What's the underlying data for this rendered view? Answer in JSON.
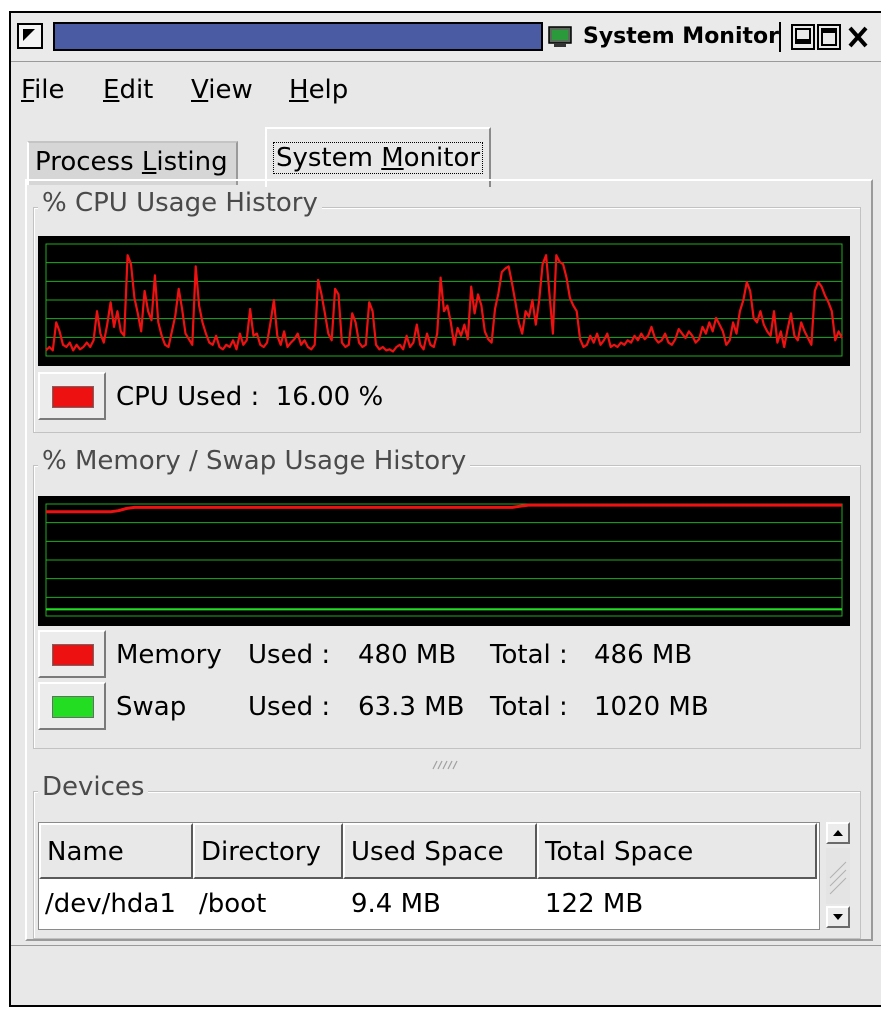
{
  "window": {
    "title": "System Monitor",
    "menu_icon": "triangle-menu-icon",
    "buttons": [
      "minimize-icon",
      "maximize-icon",
      "close-icon"
    ]
  },
  "menubar": [
    {
      "underline": "F",
      "rest": "ile"
    },
    {
      "underline": "E",
      "rest": "dit"
    },
    {
      "underline": "V",
      "rest": "iew"
    },
    {
      "underline": "H",
      "rest": "elp"
    }
  ],
  "tabs": {
    "process": {
      "before": "Process ",
      "underline": "L",
      "after": "isting"
    },
    "sysmon": {
      "before": "System ",
      "underline": "M",
      "after": "onitor"
    },
    "active": "System Monitor"
  },
  "cpu": {
    "title": "% CPU Usage History",
    "legend_label": "CPU Used :",
    "legend_value": "16.00 %",
    "color": "#ee1111"
  },
  "memory": {
    "title": "% Memory / Swap Usage History",
    "mem_name": "Memory",
    "mem_used_label": "Used :",
    "mem_used_value": "480 MB",
    "mem_total_label": "Total :",
    "mem_total_value": "486 MB",
    "swap_name": "Swap",
    "swap_used_label": "Used :",
    "swap_used_value": "63.3 MB",
    "swap_total_label": "Total :",
    "swap_total_value": "1020 MB",
    "mem_color": "#ee1111",
    "swap_color": "#22dd22"
  },
  "devices": {
    "title": "Devices",
    "columns": [
      "Name",
      "Directory",
      "Used Space",
      "Total Space"
    ],
    "rows": [
      {
        "name": "/dev/hda1",
        "directory": "/boot",
        "used": "9.4 MB",
        "total": "122 MB"
      }
    ]
  },
  "colors": {
    "graph_bg": "#000000",
    "grid": "#22aa22",
    "cpu_line": "#ee1111",
    "mem_line": "#ee1111",
    "swap_line": "#22dd22",
    "title_bar": "#4a5aa3"
  },
  "chart_data": [
    {
      "type": "line",
      "name": "cpu-usage-history",
      "series": [
        {
          "values": [
            5,
            8,
            5,
            30,
            22,
            10,
            8,
            12,
            5,
            10,
            6,
            8,
            12,
            8,
            14,
            40,
            20,
            12,
            28,
            48,
            26,
            40,
            22,
            18,
            90,
            82,
            52,
            38,
            22,
            58,
            40,
            32,
            72,
            30,
            18,
            10,
            8,
            22,
            36,
            60,
            42,
            20,
            15,
            10,
            80,
            45,
            30,
            20,
            12,
            10,
            18,
            8,
            6,
            10,
            8,
            14,
            6,
            20,
            10,
            14,
            42,
            18,
            20,
            10,
            8,
            12,
            30,
            50,
            18,
            10,
            22,
            8,
            12,
            15,
            20,
            10,
            14,
            8,
            6,
            10,
            68,
            55,
            38,
            20,
            14,
            60,
            55,
            12,
            8,
            10,
            38,
            30,
            12,
            8,
            10,
            48,
            40,
            10,
            6,
            8,
            5,
            6,
            4,
            8,
            10,
            6,
            18,
            8,
            12,
            28,
            10,
            6,
            20,
            10,
            8,
            20,
            70,
            40,
            45,
            30,
            10,
            25,
            18,
            28,
            15,
            62,
            38,
            55,
            45,
            22,
            15,
            12,
            42,
            56,
            75,
            78,
            80,
            65,
            48,
            30,
            20,
            40,
            35,
            50,
            28,
            50,
            82,
            90,
            55,
            20,
            90,
            84,
            82,
            70,
            52,
            45,
            40,
            15,
            8,
            10,
            18,
            12,
            20,
            10,
            14,
            20,
            8,
            10,
            8,
            12,
            10,
            14,
            12,
            18,
            14,
            20,
            15,
            18,
            26,
            16,
            12,
            14,
            20,
            12,
            10,
            15,
            24,
            20,
            16,
            22,
            18,
            12,
            15,
            26,
            20,
            30,
            22,
            34,
            28,
            22,
            10,
            14,
            30,
            20,
            40,
            50,
            66,
            58,
            34,
            30,
            40,
            28,
            22,
            18,
            40,
            12,
            22,
            8,
            24,
            38,
            18,
            14,
            30,
            22,
            16,
            10,
            58,
            66,
            62,
            54,
            48,
            40,
            14,
            22,
            16
          ]
        }
      ]
    },
    {
      "type": "line",
      "name": "memory-swap-usage-history",
      "series": [
        {
          "name": "Memory",
          "values": [
            93,
            93,
            93,
            93,
            93,
            93,
            93,
            93,
            93,
            94,
            96,
            97,
            97,
            97,
            97,
            97,
            97,
            97,
            97,
            97,
            97,
            97,
            97,
            97,
            97,
            97,
            97,
            97,
            97,
            97,
            97,
            97,
            97,
            97,
            97,
            97,
            97,
            97,
            97,
            97,
            97,
            97,
            97,
            97,
            97,
            97,
            97,
            97,
            97,
            97,
            97,
            97,
            97,
            97,
            97,
            97,
            97,
            97,
            97,
            98,
            99,
            99,
            99,
            99,
            99,
            99,
            99,
            99,
            99,
            99,
            99,
            99,
            99,
            99,
            99,
            99,
            99,
            99,
            99,
            99,
            99,
            99,
            99,
            99,
            99,
            99,
            99,
            99,
            99,
            99,
            99,
            99,
            99,
            99,
            99,
            99,
            99,
            99,
            99,
            99
          ]
        },
        {
          "name": "Swap",
          "values": [
            6,
            6,
            6,
            6,
            6,
            6,
            6,
            6,
            6,
            6,
            6,
            6,
            6,
            6,
            6,
            6,
            6,
            6,
            6,
            6,
            6,
            6,
            6,
            6,
            6,
            6,
            6,
            6,
            6,
            6,
            6,
            6,
            6,
            6,
            6,
            6,
            6,
            6,
            6,
            6,
            6,
            6,
            6,
            6,
            6,
            6,
            6,
            6,
            6,
            6,
            6,
            6,
            6,
            6,
            6,
            6,
            6,
            6,
            6,
            6,
            6,
            6,
            6,
            6,
            6,
            6,
            6,
            6,
            6,
            6,
            6,
            6,
            6,
            6,
            6,
            6,
            6,
            6,
            6,
            6,
            6,
            6,
            6,
            6,
            6,
            6,
            6,
            6,
            6,
            6,
            6,
            6,
            6,
            6,
            6,
            6,
            6,
            6,
            6,
            6
          ]
        }
      ]
    }
  ]
}
